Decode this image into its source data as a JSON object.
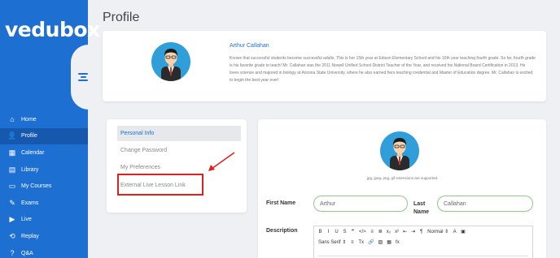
{
  "app": {
    "brand": "vedubox",
    "brand_color": "#1d6fd1"
  },
  "sidebar": {
    "items": [
      {
        "label": "Home",
        "icon": "home-icon",
        "glyph": "⌂"
      },
      {
        "label": "Profile",
        "icon": "user-icon",
        "glyph": "👤",
        "active": true
      },
      {
        "label": "Calendar",
        "icon": "calendar-icon",
        "glyph": "▦"
      },
      {
        "label": "Library",
        "icon": "library-icon",
        "glyph": "▤"
      },
      {
        "label": "My Courses",
        "icon": "courses-icon",
        "glyph": "▭"
      },
      {
        "label": "Exams",
        "icon": "exams-icon",
        "glyph": "✎"
      },
      {
        "label": "Live",
        "icon": "live-icon",
        "glyph": "▶"
      },
      {
        "label": "Replay",
        "icon": "replay-icon",
        "glyph": "⟲"
      },
      {
        "label": "Q&A",
        "icon": "help-icon",
        "glyph": "?"
      }
    ]
  },
  "page": {
    "title": "Profile"
  },
  "profile": {
    "name": "Arthur Callahan",
    "bio": "Knows that successful students become successful adults. This is her 15th year at Edison Elementary School and his 10th year teaching fourth grade. So far, fourth grade is his favorite grade to teach! Mr. Callahan was the 2011 Nowell Unified School District Teacher of the Year, and received his National Board Certification in 2013. He loves science and majored in biology at Arizona State University, where he also earned hers teaching credential and Master of Education degree. Mr. Callahan is excited to begin the best year ever!"
  },
  "settings_menu": {
    "items": [
      {
        "label": "Personal Info",
        "active": true
      },
      {
        "label": "Change Password"
      },
      {
        "label": "My Preferences"
      },
      {
        "label": "External Live Lesson Link",
        "highlighted": true
      }
    ]
  },
  "form": {
    "upload_hint": "jpg, jpeg, png, gif extensions are supported",
    "first_name_label": "First Name",
    "first_name_value": "Arthur",
    "last_name_label": "Last Name",
    "last_name_value": "Callahan",
    "description_label": "Description",
    "toolbar": {
      "row1": [
        "B",
        "I",
        "U",
        "S",
        "❞",
        "</>",
        "≡",
        "≣",
        "x₂",
        "x²",
        "⇤",
        "⇥",
        "¶",
        "Normal ⇕",
        "A",
        "▣"
      ],
      "row2": [
        "Sans Serif ⇕",
        "≡",
        "Tx",
        "🔗",
        "▨",
        "▦",
        "fx"
      ]
    }
  }
}
